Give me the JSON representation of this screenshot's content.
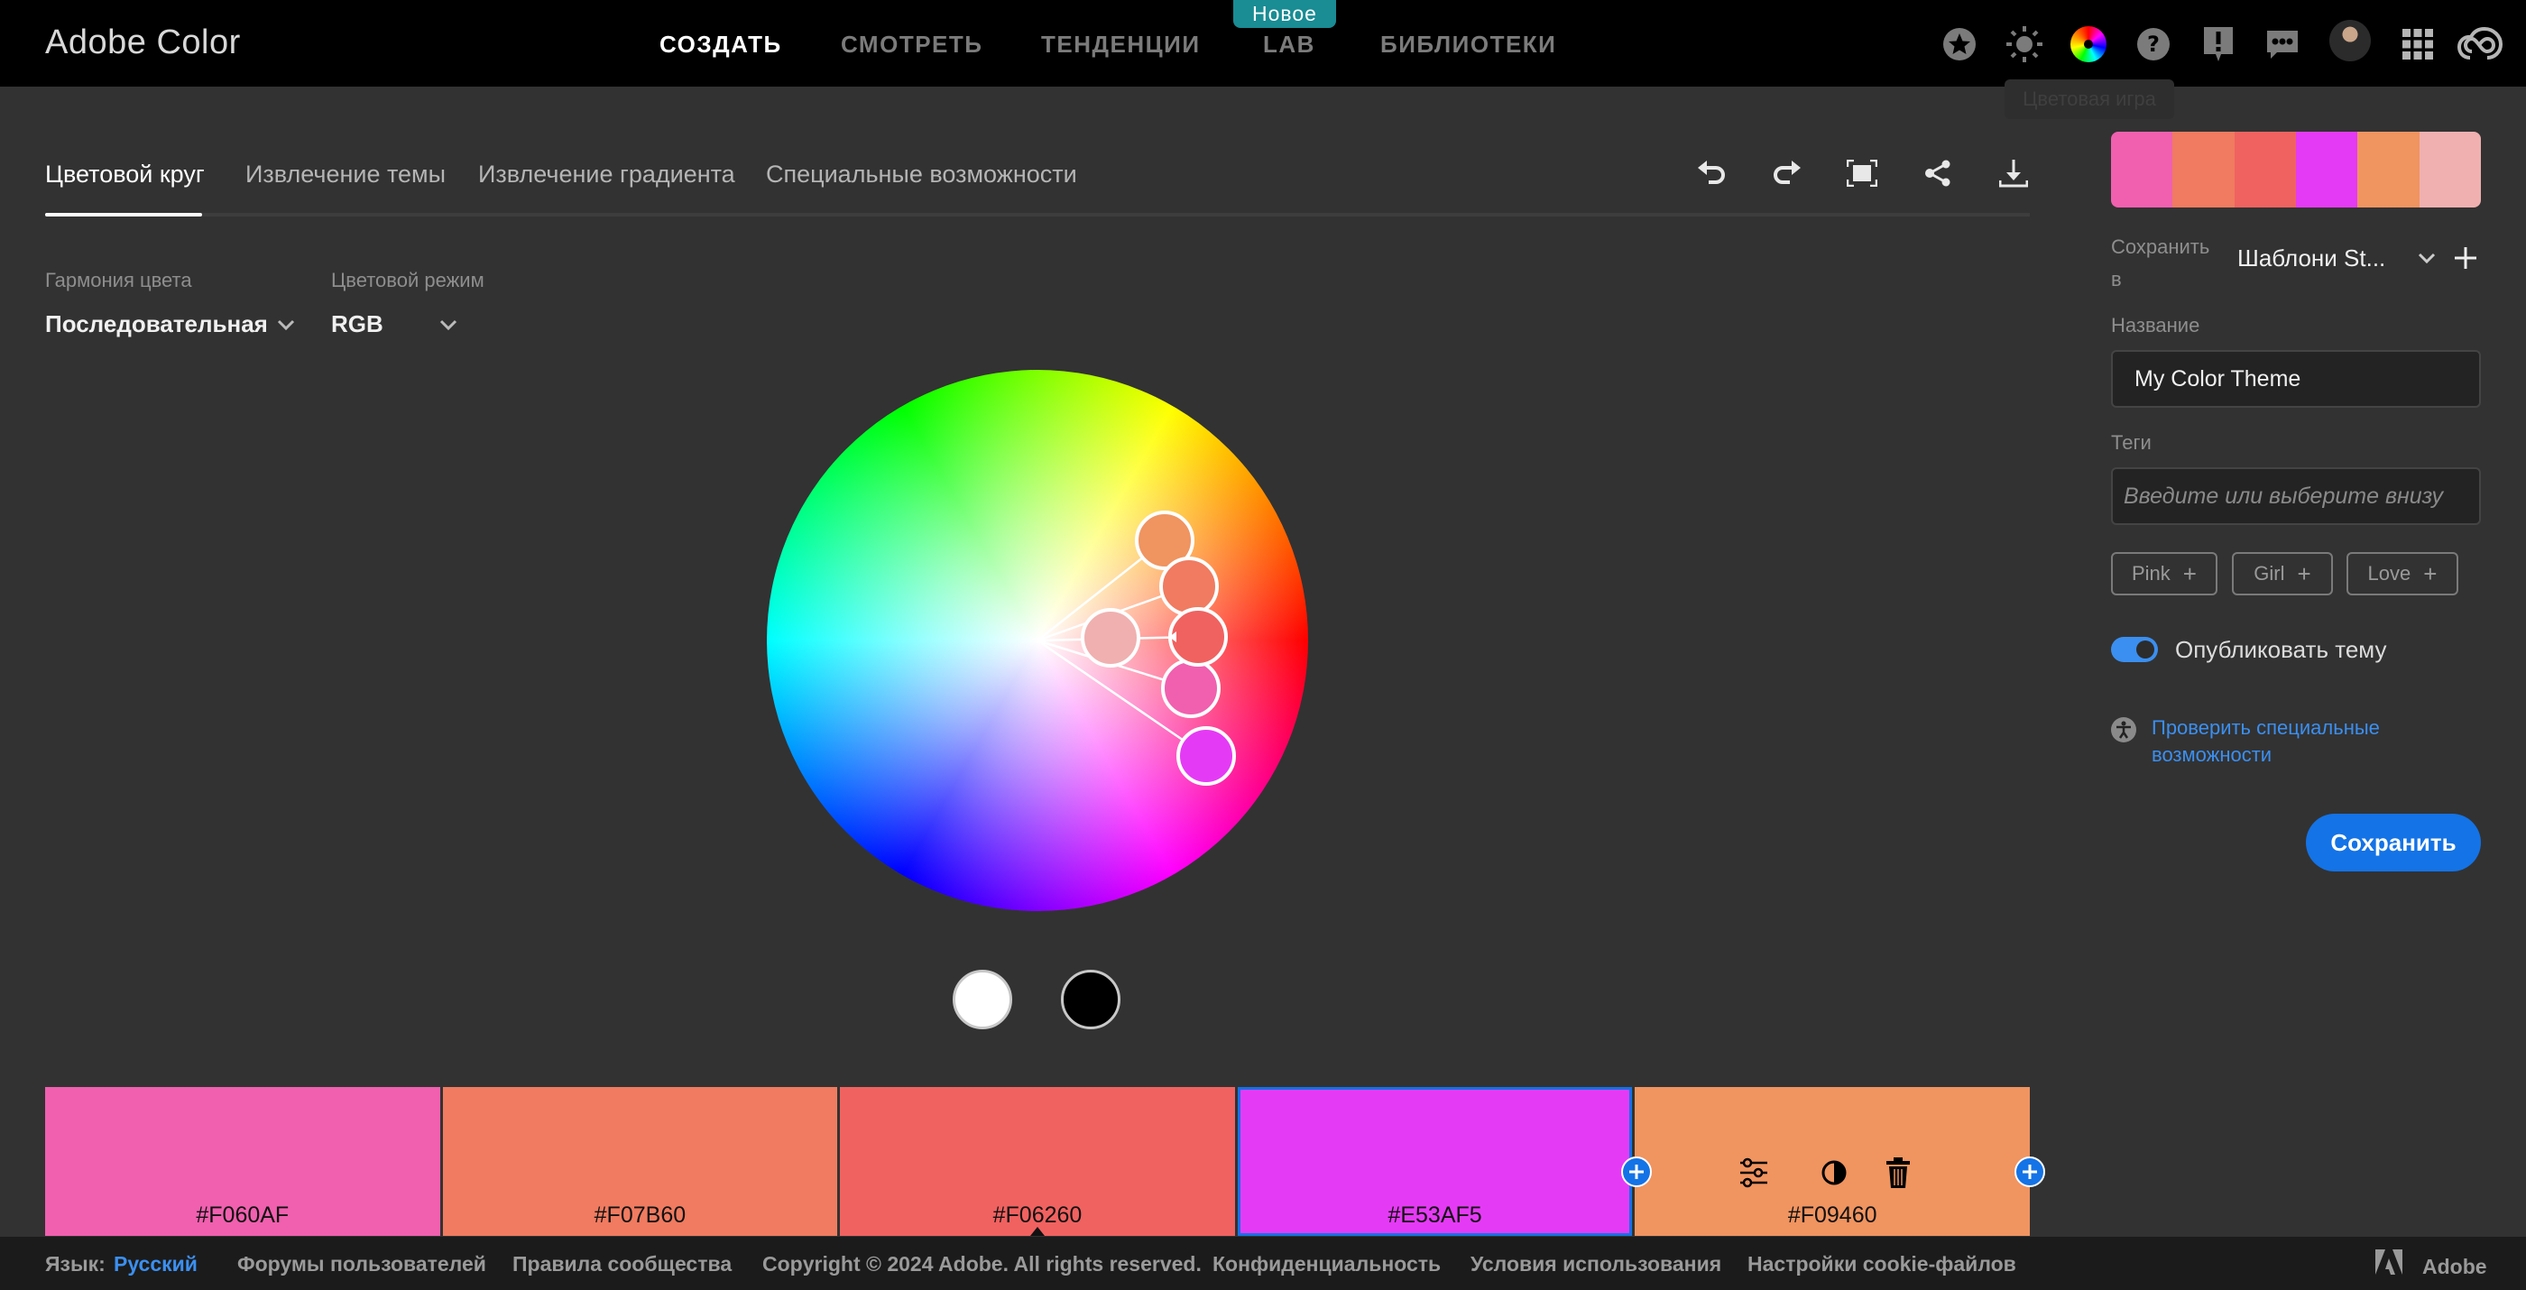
{
  "app": {
    "title": "Adobe Color",
    "nav": [
      {
        "label": "СОЗДАТЬ",
        "active": true
      },
      {
        "label": "СМОТРЕТЬ",
        "active": false
      },
      {
        "label": "ТЕНДЕНЦИИ",
        "active": false
      },
      {
        "label": "LAB",
        "active": false
      },
      {
        "label": "БИБЛИОТЕКИ",
        "active": false
      }
    ],
    "new_badge": "Новое",
    "tooltip": "Цветовая игра",
    "header_icons": [
      "star-icon",
      "brightness-icon",
      "color-game-icon",
      "help-icon",
      "report-icon",
      "feedback-icon",
      "avatar",
      "apps-grid-icon",
      "creative-cloud-icon"
    ]
  },
  "tabs": [
    {
      "label": "Цветовой круг",
      "active": true
    },
    {
      "label": "Извлечение темы",
      "active": false
    },
    {
      "label": "Извлечение градиента",
      "active": false
    },
    {
      "label": "Специальные возможности",
      "active": false
    }
  ],
  "toolbar": [
    "undo-icon",
    "redo-icon",
    "fullscreen-icon",
    "share-icon",
    "download-icon"
  ],
  "controls": {
    "harmony_label": "Гармония цвета",
    "harmony_value": "Последовательная",
    "mode_label": "Цветовой режим",
    "mode_value": "RGB"
  },
  "swatches": [
    {
      "hex": "#F060AF",
      "color": "#F060AF"
    },
    {
      "hex": "#F07B60",
      "color": "#F07B60"
    },
    {
      "hex": "#F06260",
      "color": "#F06260",
      "base": true
    },
    {
      "hex": "#E53AF5",
      "color": "#E53AF5",
      "selected": true
    },
    {
      "hex": "#F09460",
      "color": "#F09460"
    }
  ],
  "wheel_handles": [
    {
      "color": "#F09460"
    },
    {
      "color": "#F07B60"
    },
    {
      "color": "#F06260"
    },
    {
      "color": "#F060AF"
    },
    {
      "color": "#E53AF5"
    },
    {
      "color": "#F0B0B0"
    }
  ],
  "sidebar": {
    "palette": [
      "#F060AF",
      "#F07B60",
      "#F06260",
      "#E53AF5",
      "#F09460",
      "#F0B0B0"
    ],
    "save_to_label": "Сохранить в",
    "library_value": "Шаблони St...",
    "name_label": "Название",
    "name_value": "My Color Theme",
    "tags_label": "Теги",
    "tags_placeholder": "Введите или выберите внизу",
    "tags": [
      "Pink",
      "Girl",
      "Love"
    ],
    "publish_label": "Опубликовать тему",
    "publish_on": true,
    "accessibility_link": "Проверить специальные возможности",
    "save_button": "Сохранить"
  },
  "footer": {
    "language_label": "Язык:",
    "language_value": "Русский",
    "links": [
      "Форумы пользователей",
      "Правила сообщества",
      "Copyright © 2024 Adobe. All rights reserved.",
      "Конфиденциальность",
      "Условия использования",
      "Настройки cookie-файлов"
    ],
    "brand": "Adobe"
  }
}
